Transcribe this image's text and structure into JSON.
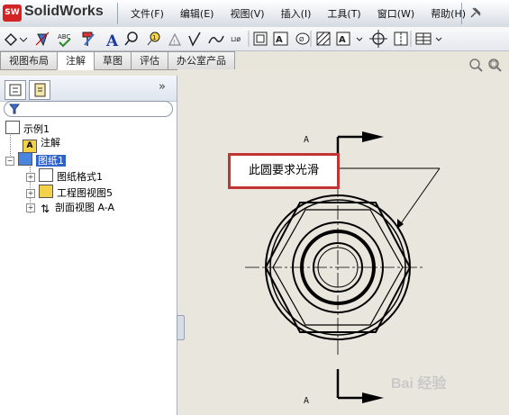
{
  "app": {
    "logo_text": "SW",
    "brand": "SolidWorks"
  },
  "menu": [
    "文件(F)",
    "编辑(E)",
    "视图(V)",
    "插入(I)",
    "工具(T)",
    "窗口(W)",
    "帮助(H)"
  ],
  "toolbar_icons": [
    "smart-dimension-icon",
    "model-items-icon",
    "spell-checker-icon",
    "format-painter-icon",
    "note-icon",
    "balloon-icon",
    "auto-balloon-icon",
    "datum-feature-icon",
    "surface-finish-icon",
    "weld-symbol-icon",
    "hole-callout-icon",
    "geometric-tolerance-icon",
    "datum-target-icon",
    "block-icon",
    "area-hatch-icon",
    "center-mark-icon",
    "table-icon"
  ],
  "tabs": [
    {
      "label": "视图布局"
    },
    {
      "label": "注解",
      "active": true
    },
    {
      "label": "草图"
    },
    {
      "label": "评估"
    },
    {
      "label": "办公室产品"
    }
  ],
  "tree": {
    "root": "示例1",
    "items": [
      {
        "label": "注解"
      },
      {
        "label": "图纸1",
        "selected": true
      },
      {
        "label": "图纸格式1"
      },
      {
        "label": "工程图视图5"
      },
      {
        "label": "剖面视图 A-A"
      }
    ]
  },
  "drawing": {
    "callout_text": "此圆要求光滑",
    "section_label_top": "A",
    "section_label_bottom": "A"
  },
  "watermark": "Bai 经验"
}
